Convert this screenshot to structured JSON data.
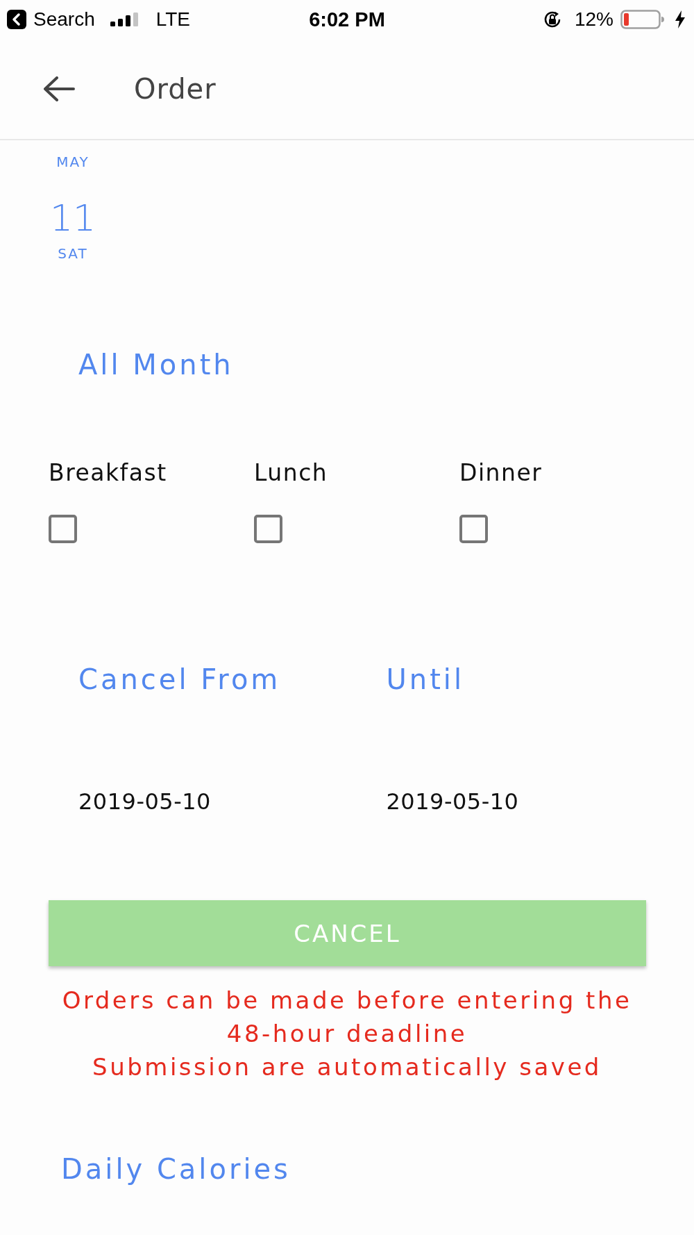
{
  "status_bar": {
    "back_label": "Search",
    "network": "LTE",
    "time": "6:02 PM",
    "battery_percent": "12%"
  },
  "header": {
    "title": "Order"
  },
  "date": {
    "month": "MAY",
    "day": "11",
    "weekday": "SAT"
  },
  "range_label": "All Month",
  "meals": [
    {
      "label": "Breakfast",
      "checked": false
    },
    {
      "label": "Lunch",
      "checked": false
    },
    {
      "label": "Dinner",
      "checked": false
    }
  ],
  "cancel_range": [
    {
      "label": "Cancel From",
      "value": "2019-05-10"
    },
    {
      "label": "Until",
      "value": "2019-05-10"
    }
  ],
  "cancel_button": {
    "label": "CANCEL"
  },
  "notice": [
    "Orders can be made before entering the 48-hour deadline",
    "Submission are automatically saved"
  ],
  "section_title": "Daily Calories"
}
